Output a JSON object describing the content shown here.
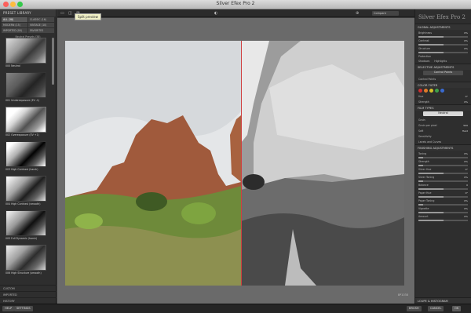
{
  "window": {
    "title": "Silver Efex Pro 2"
  },
  "left_panel": {
    "header": "PRESET LIBRARY",
    "tabs": [
      {
        "label": "ALL (38)",
        "active": true
      },
      {
        "label": "CLASSIC (16)"
      },
      {
        "label": "MODERN (15)"
      },
      {
        "label": "VINTAGE (10)"
      },
      {
        "label": "IMPORTED (00)"
      },
      {
        "label": "FAVORITES"
      }
    ],
    "preset_section": "Neutral Presets (38)",
    "presets": [
      "000 Neutral",
      "001 Underexposure (EV -1)",
      "002 Overexposure (EV +1)",
      "003 High Contrast (harsh)",
      "004 High Contrast (smooth)",
      "005 Full Dynamic (harsh)",
      "006 High Structure (smooth)"
    ],
    "bottom_sections": [
      "CUSTOM",
      "IMPORTED",
      "HISTORY"
    ]
  },
  "toolbar": {
    "tooltip": "Split preview",
    "compare_label": "Compare"
  },
  "canvas": {
    "caption": "8P1038"
  },
  "right_panel": {
    "title": "Silver Efex Pro 2",
    "global_section": "GLOBAL ADJUSTMENTS",
    "global_rows": [
      {
        "label": "Brightness",
        "value": "0%",
        "fill": 0.5
      },
      {
        "label": "Contrast",
        "value": "0%",
        "fill": 0.5
      },
      {
        "label": "Structure",
        "value": "0%",
        "fill": 0.5
      }
    ],
    "highlights_label": "Soft Contrast",
    "protection": {
      "label": "Protection",
      "opt1": "Shadows",
      "opt2": "Highlights"
    },
    "selective_section": "SELECTIVE ADJUSTMENTS",
    "control_points_btn": "Control Points",
    "burn_label": "Control Points",
    "color_filter_section": "COLOR FILTER",
    "filter_dots": [
      "#d03030",
      "#e07b2a",
      "#d7c12a",
      "#3ea14a",
      "#3a6ad0"
    ],
    "filter_rows": [
      {
        "label": "Hue",
        "value": "0°",
        "fill": 0.3
      },
      {
        "label": "Strength",
        "value": "0%",
        "fill": 0.2
      }
    ],
    "film_section": "FILM TYPES",
    "film_select": "Neutral",
    "film_grain_label": "Grain",
    "grain_rows": [
      {
        "label": "Grain per pixel",
        "value": "500",
        "fill": 0.7
      },
      {
        "label": "Soft",
        "value": "Hard",
        "fill": 0.5
      }
    ],
    "sensitivity_label": "Sensitivity",
    "levels_label": "Levels and Curves",
    "finishing_section": "FINISHING ADJUSTMENTS",
    "finishing_rows": [
      {
        "label": "Toning",
        "value": "0%",
        "fill": 0.1
      },
      {
        "label": "Strength",
        "value": "0%",
        "fill": 0.1
      },
      {
        "label": "Silver Hue",
        "value": "0°",
        "fill": 0.5
      },
      {
        "label": "Silver Toning",
        "value": "0%",
        "fill": 0.1
      },
      {
        "label": "Balance",
        "value": "0",
        "fill": 0.5
      },
      {
        "label": "Paper Hue",
        "value": "0°",
        "fill": 0.5
      },
      {
        "label": "Paper Toning",
        "value": "0%",
        "fill": 0.1
      },
      {
        "label": "Vignette",
        "value": "0%",
        "fill": 0.5
      },
      {
        "label": "Amount",
        "value": "0%",
        "fill": 0.5
      }
    ],
    "loupe_section": "LOUPE & HISTOGRAM"
  },
  "bottom": {
    "help": "HELP",
    "settings": "SETTINGS",
    "brush": "BRUSH",
    "cancel": "CANCEL",
    "ok": "OK"
  }
}
